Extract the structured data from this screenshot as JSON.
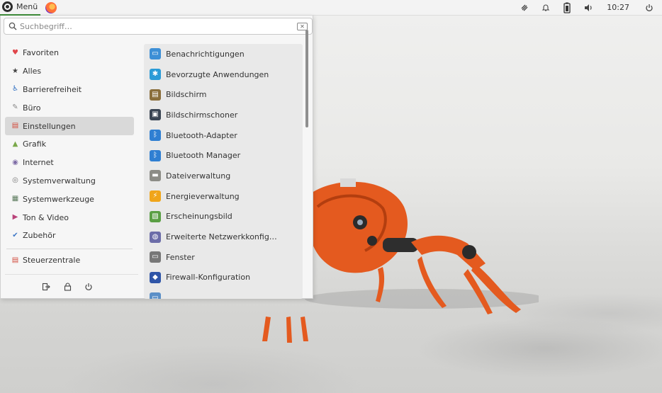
{
  "panel": {
    "menu_label": "Menü",
    "clock": "10:27"
  },
  "search": {
    "placeholder": "Suchbegriff…"
  },
  "categories": [
    {
      "label": "Favoriten",
      "icon": "heart-icon",
      "color": "#e0464b"
    },
    {
      "label": "Alles",
      "icon": "star-icon",
      "color": "#444444"
    },
    {
      "label": "Barrierefreiheit",
      "icon": "accessibility-icon",
      "color": "#2f6fc1"
    },
    {
      "label": "Büro",
      "icon": "office-icon",
      "color": "#8a8a8a"
    },
    {
      "label": "Einstellungen",
      "icon": "settings-icon",
      "color": "#d24b3c",
      "active": true
    },
    {
      "label": "Grafik",
      "icon": "graphics-icon",
      "color": "#7aa84a"
    },
    {
      "label": "Internet",
      "icon": "globe-icon",
      "color": "#7d6ba6"
    },
    {
      "label": "Systemverwaltung",
      "icon": "system-admin-icon",
      "color": "#777777"
    },
    {
      "label": "Systemwerkzeuge",
      "icon": "system-tools-icon",
      "color": "#5b7a5c"
    },
    {
      "label": "Ton & Video",
      "icon": "multimedia-icon",
      "color": "#b9437a"
    },
    {
      "label": "Zubehör",
      "icon": "accessories-icon",
      "color": "#3f78c7"
    }
  ],
  "control_center": {
    "label": "Steuerzentrale",
    "icon": "control-center-icon",
    "color": "#d24b3c"
  },
  "apps": [
    {
      "label": "Benachrichtigungen",
      "icon": "notifications-icon",
      "color": "#3d8fd6"
    },
    {
      "label": "Bevorzugte Anwendungen",
      "icon": "preferred-apps-icon",
      "color": "#2a9bd7"
    },
    {
      "label": "Bildschirm",
      "icon": "display-icon",
      "color": "#8a6e3b"
    },
    {
      "label": "Bildschirmschoner",
      "icon": "screensaver-icon",
      "color": "#3a4553"
    },
    {
      "label": "Bluetooth-Adapter",
      "icon": "bluetooth-icon",
      "color": "#2f7fd2"
    },
    {
      "label": "Bluetooth Manager",
      "icon": "bluetooth-icon",
      "color": "#2f7fd2"
    },
    {
      "label": "Dateiverwaltung",
      "icon": "folder-icon",
      "color": "#8c8c86"
    },
    {
      "label": "Energieverwaltung",
      "icon": "power-manager-icon",
      "color": "#f0a51a"
    },
    {
      "label": "Erscheinungsbild",
      "icon": "appearance-icon",
      "color": "#5a9f44"
    },
    {
      "label": "Erweiterte Netzwerkkonfig…",
      "icon": "network-icon",
      "color": "#6b6ca8"
    },
    {
      "label": "Fenster",
      "icon": "window-icon",
      "color": "#777777"
    },
    {
      "label": "Firewall-Konfiguration",
      "icon": "firewall-icon",
      "color": "#2f55a8"
    },
    {
      "label": "",
      "icon": "app-icon",
      "color": "#5b8fc7"
    }
  ]
}
